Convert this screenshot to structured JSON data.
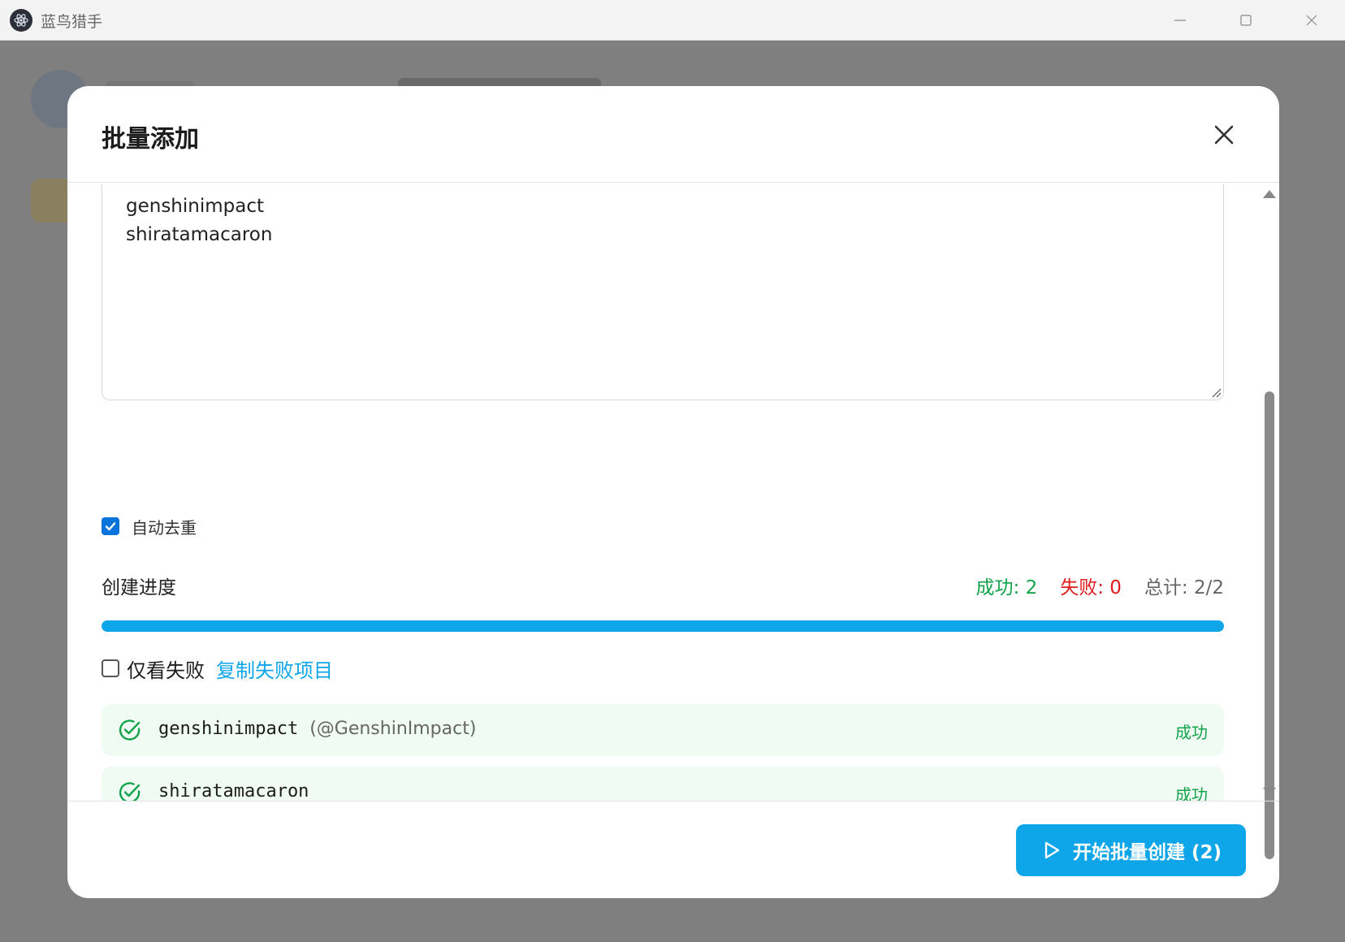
{
  "window": {
    "title": "蓝鸟猎手",
    "minimize_icon": "minimize-icon",
    "maximize_icon": "maximize-icon",
    "close_icon": "close-icon"
  },
  "modal": {
    "title": "批量添加",
    "textarea": {
      "lines": [
        "genshinimpact",
        "shiratamacaron"
      ]
    },
    "dedupe": {
      "label": "自动去重",
      "checked": true
    },
    "progress": {
      "title": "创建进度",
      "success_text": "成功: 2",
      "fail_text": "失败: 0",
      "total_text": "总计: 2/2",
      "completed": 2,
      "total": 2
    },
    "filter": {
      "label": "仅看失败",
      "checked": false,
      "copy_link": "复制失败项目"
    },
    "results": [
      {
        "name": "genshinimpact",
        "handle": "(@GenshinImpact)",
        "status": "成功"
      },
      {
        "name": "shiratamacaron",
        "handle": "",
        "status": "成功"
      }
    ],
    "start_button": "开始批量创建 (2)"
  },
  "colors": {
    "accent": "#0ea5e9",
    "success": "#13a34a",
    "fail": "#e01b1b",
    "result_bg": "#effbf3"
  }
}
